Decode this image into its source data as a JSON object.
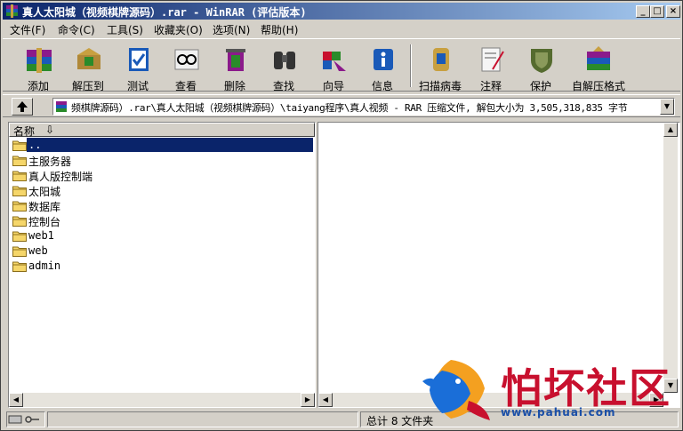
{
  "window": {
    "title": "真人太阳城（视频棋牌源码）.rar - WinRAR (评估版本)",
    "controls": {
      "minimize": "_",
      "maximize": "□",
      "close": "×"
    }
  },
  "menu": [
    "文件(F)",
    "命令(C)",
    "工具(S)",
    "收藏夹(O)",
    "选项(N)",
    "帮助(H)"
  ],
  "toolbar": [
    {
      "label": "添加",
      "icon": "add-books-icon"
    },
    {
      "label": "解压到",
      "icon": "extract-to-icon"
    },
    {
      "label": "测试",
      "icon": "test-icon"
    },
    {
      "label": "查看",
      "icon": "view-glasses-icon"
    },
    {
      "label": "删除",
      "icon": "delete-icon"
    },
    {
      "label": "查找",
      "icon": "find-binoculars-icon"
    },
    {
      "label": "向导",
      "icon": "wizard-icon"
    },
    {
      "label": "信息",
      "icon": "info-icon"
    },
    {
      "label": "扫描病毒",
      "icon": "virus-scan-icon"
    },
    {
      "label": "注释",
      "icon": "comment-icon"
    },
    {
      "label": "保护",
      "icon": "protect-shield-icon"
    },
    {
      "label": "自解压格式",
      "icon": "sfx-icon"
    }
  ],
  "address": {
    "text": "频棋牌源码）.rar\\真人太阳城（视频棋牌源码）\\taiyang程序\\真人视频 - RAR 压缩文件, 解包大小为 3,505,318,835 字节"
  },
  "list_header": {
    "name_column": "名称"
  },
  "tree_items": [
    {
      "name": "..",
      "selected": true,
      "mono": true
    },
    {
      "name": "主服务器",
      "selected": false,
      "mono": false
    },
    {
      "name": "真人版控制端",
      "selected": false,
      "mono": false
    },
    {
      "name": "太阳城",
      "selected": false,
      "mono": false
    },
    {
      "name": "数据库",
      "selected": false,
      "mono": false
    },
    {
      "name": "控制台",
      "selected": false,
      "mono": false
    },
    {
      "name": "web1",
      "selected": false,
      "mono": true
    },
    {
      "name": "web",
      "selected": false,
      "mono": true
    },
    {
      "name": "admin",
      "selected": false,
      "mono": true
    }
  ],
  "status": {
    "total": "总计 8 文件夹"
  },
  "watermark": {
    "title": "怕坏社区",
    "url": "www.pahuai.com"
  },
  "colors": {
    "title_start": "#0a246a",
    "title_end": "#a6caf0",
    "selection": "#0a246a",
    "chrome": "#d4d0c8"
  }
}
